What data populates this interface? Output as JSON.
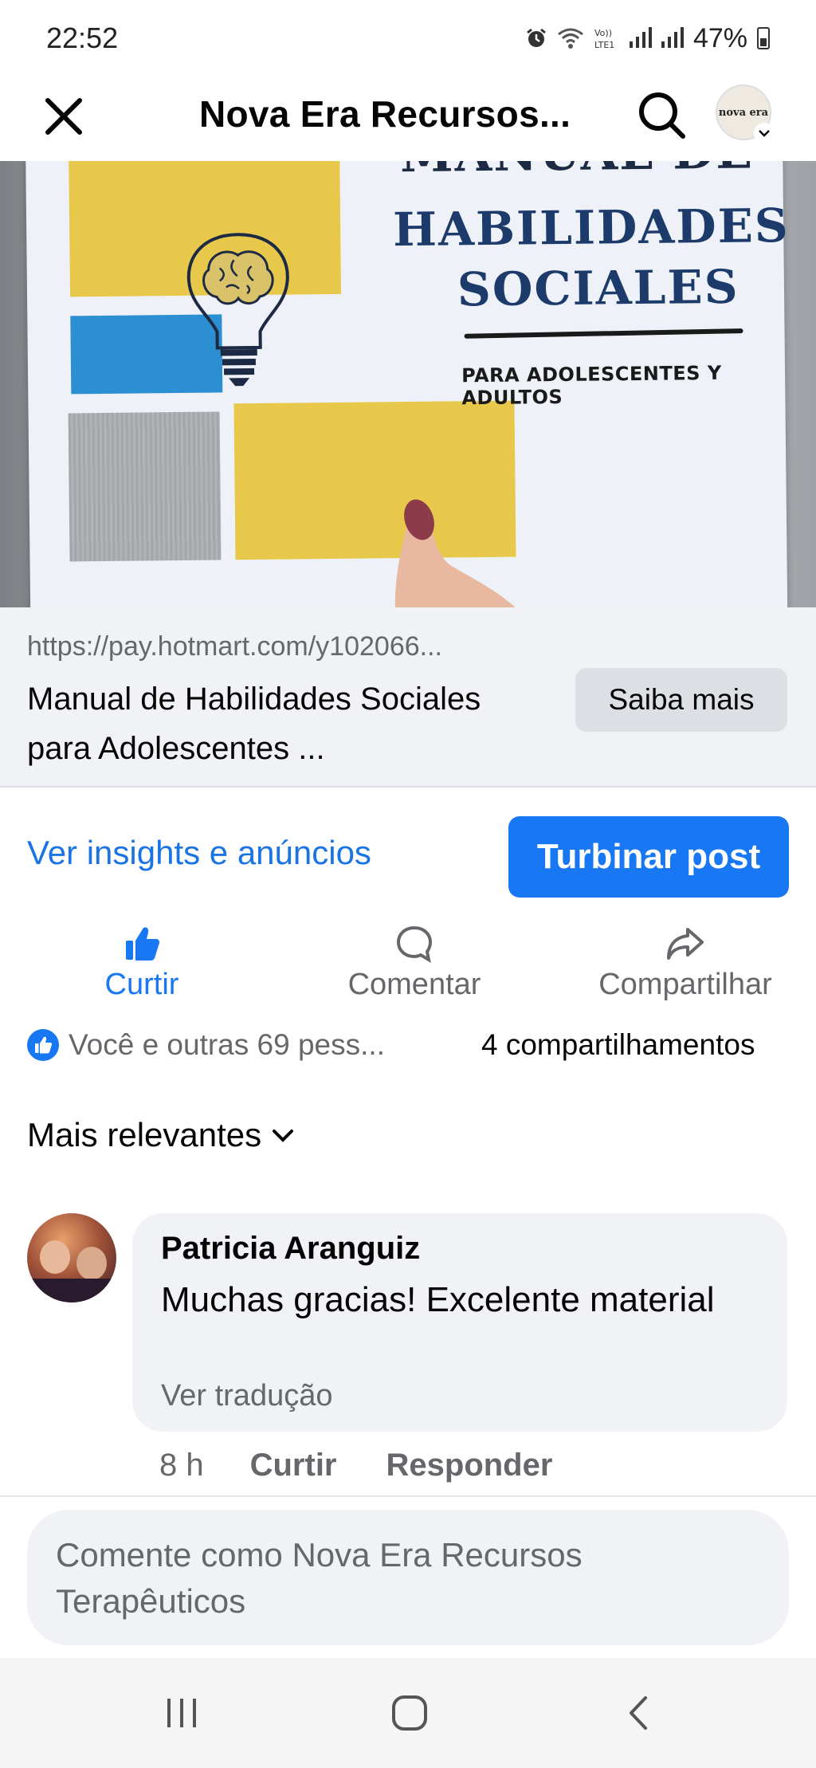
{
  "status_bar": {
    "time": "22:52",
    "battery": "47%",
    "icons": [
      "alarm-icon",
      "wifi-icon",
      "signal-icon",
      "signal-icon",
      "battery-icon"
    ]
  },
  "header": {
    "title": "Nova Era Recursos...",
    "avatar_text": "nova era"
  },
  "post_image": {
    "manual_text": "MANUAL DE",
    "title_line1": "HABILIDADES",
    "title_line2": "SOCIALES",
    "subtitle": "PARA ADOLESCENTES Y ADULTOS"
  },
  "link_preview": {
    "url": "https://pay.hotmart.com/y102066...",
    "title": "Manual de Habilidades Sociales para Adolescentes ...",
    "button_label": "Saiba mais"
  },
  "insights": {
    "link_label": "Ver insights e anúncios",
    "boost_label": "Turbinar post"
  },
  "actions": {
    "like": "Curtir",
    "comment": "Comentar",
    "share": "Compartilhar"
  },
  "reactions": {
    "summary": "Você e outras 69 pess...",
    "shares": "4 compartilhamentos"
  },
  "sort": {
    "label": "Mais relevantes"
  },
  "comment": {
    "author": "Patricia Aranguiz",
    "text": "Muchas gracias! Excelente material",
    "translate": "Ver tradução",
    "time": "8 h",
    "like": "Curtir",
    "reply": "Responder"
  },
  "composer": {
    "placeholder": "Comente como Nova Era Recursos Terapêuticos"
  },
  "colors": {
    "accent": "#1877f2",
    "link": "#1b74e4",
    "muted": "#65676b",
    "surface": "#f0f2f5"
  }
}
